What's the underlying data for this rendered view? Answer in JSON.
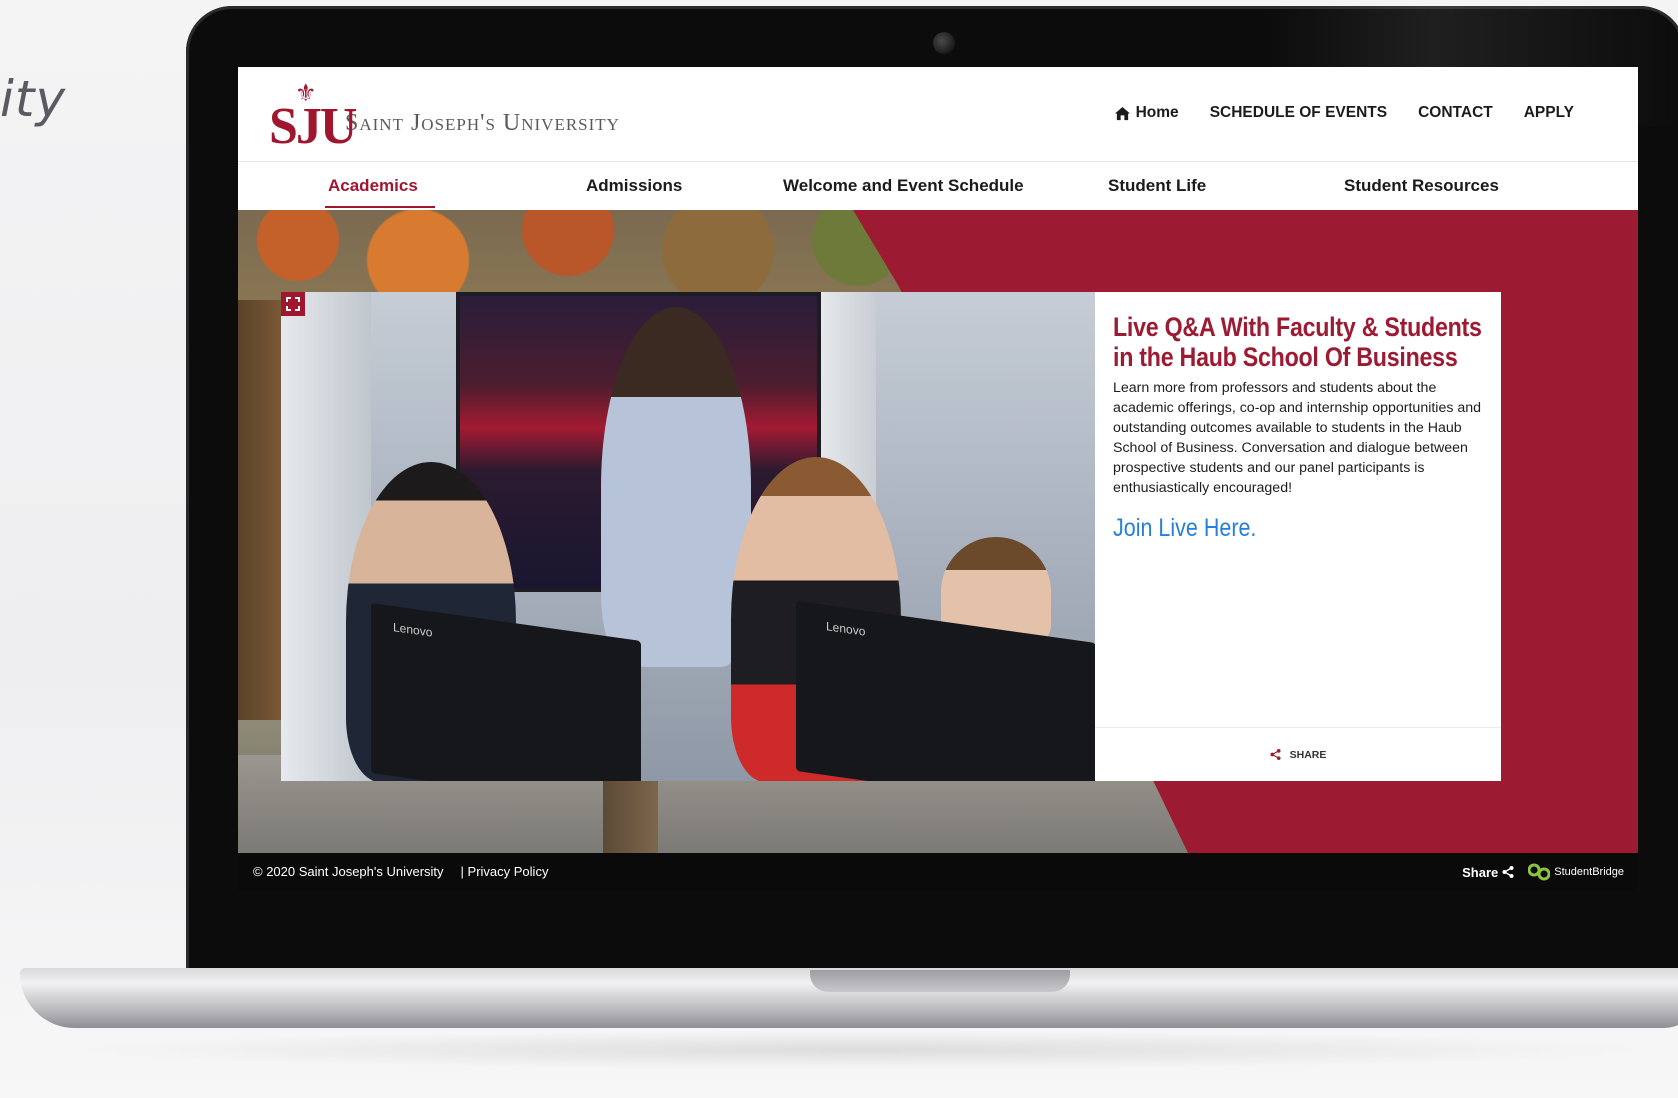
{
  "backdrop": {
    "partial_tagline": "ity"
  },
  "site": {
    "logo_mark": "SJU",
    "logo_name": "Saint Joseph's University"
  },
  "top_nav": {
    "home": "Home",
    "schedule": "SCHEDULE OF EVENTS",
    "contact": "CONTACT",
    "apply": "APPLY"
  },
  "main_nav": {
    "items": [
      {
        "label": "Academics",
        "active": true
      },
      {
        "label": "Admissions"
      },
      {
        "label": "Welcome and Event Schedule"
      },
      {
        "label": "Student Life"
      },
      {
        "label": "Student Resources"
      }
    ]
  },
  "feature": {
    "title": "Live Q&A With Faculty & Students in the Haub School Of Business",
    "body": "Learn more from professors and students about the academic offerings, co-op and internship opportunities and outstanding outcomes available to students in the Haub School of Business.  Conversation and dialogue between prospective students and our panel participants is enthusiastically encouraged!",
    "link": "Join Live Here.",
    "share": "SHARE",
    "monitor_brand": "Lenovo"
  },
  "footer": {
    "copyright": "© 2020 Saint Joseph's University",
    "privacy": "| Privacy Policy",
    "share": "Share",
    "brand": "StudentBridge"
  },
  "colors": {
    "brand_red": "#9d1b32",
    "link_blue": "#2680d9",
    "studentbridge_green": "#8cc63f"
  },
  "icons": [
    "home-icon",
    "expand-icon",
    "share-icon",
    "studentbridge-logo-icon",
    "fleur-de-lis-icon"
  ]
}
